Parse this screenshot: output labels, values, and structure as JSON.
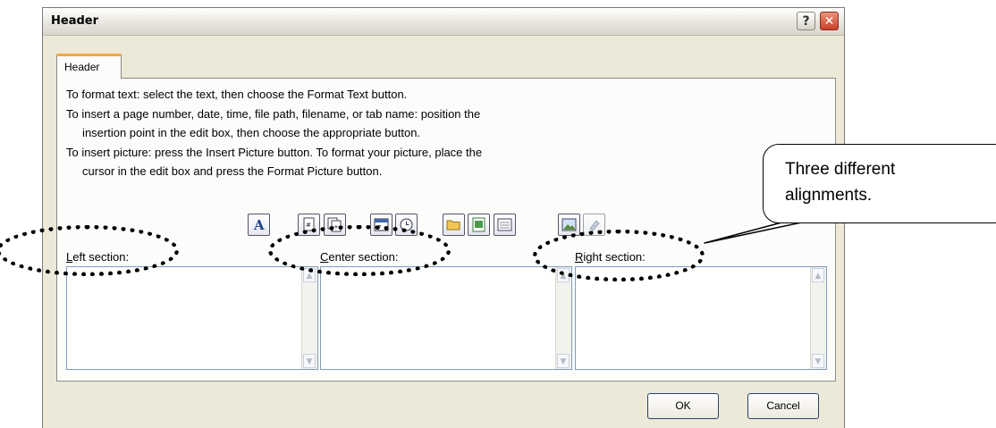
{
  "dialog": {
    "title": "Header",
    "help_glyph": "?",
    "close_glyph": "✕",
    "tab_label": "Header",
    "instructions": [
      "To format text:  select the text, then choose the Format Text button.",
      "To insert a page number, date, time, file path, filename, or tab name:  position the",
      "     insertion point in the edit box, then choose the appropriate button.",
      "To insert picture: press the Insert Picture button.  To format your picture, place the",
      "     cursor in the edit box and press the Format Picture button."
    ],
    "toolbar_icons": [
      "format-text-icon",
      "page-number-icon",
      "number-of-pages-icon",
      "date-icon",
      "time-icon",
      "file-path-icon",
      "filename-icon",
      "sheet-name-icon",
      "insert-picture-icon",
      "format-picture-icon"
    ],
    "sections": {
      "left": "Left section:",
      "center": "Center section:",
      "right": "Right section:"
    },
    "ok_label": "OK",
    "cancel_label": "Cancel"
  },
  "annotation": {
    "callout_line1": "Three different",
    "callout_line2": "alignments."
  },
  "colors": {
    "dialog_bg": "#ece9d8",
    "tab_accent": "#f1a93a",
    "close_button": "#c9402a"
  }
}
